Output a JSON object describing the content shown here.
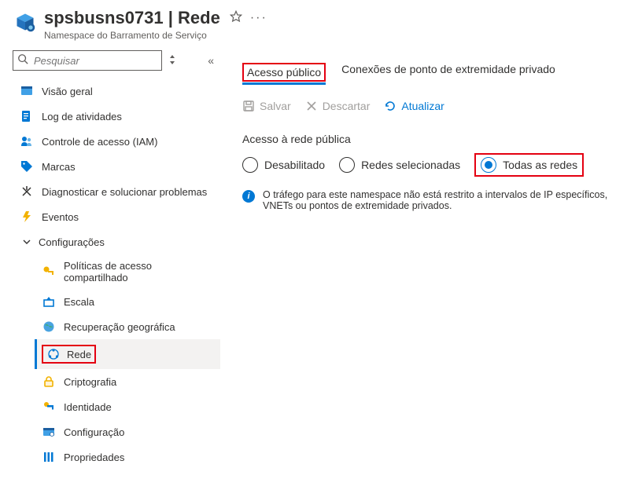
{
  "header": {
    "title": "spsbusns0731 | Rede",
    "subtitle": "Namespace do Barramento de Serviço"
  },
  "search": {
    "placeholder": "Pesquisar"
  },
  "sidebar": {
    "items": [
      {
        "label": "Visão geral"
      },
      {
        "label": "Log de atividades"
      },
      {
        "label": "Controle de acesso (IAM)"
      },
      {
        "label": "Marcas"
      },
      {
        "label": "Diagnosticar e solucionar problemas"
      },
      {
        "label": "Eventos"
      }
    ],
    "section": {
      "label": "Configurações"
    },
    "subitems": [
      {
        "label": "Políticas de acesso compartilhado"
      },
      {
        "label": "Escala"
      },
      {
        "label": "Recuperação geográfica"
      },
      {
        "label": "Rede"
      },
      {
        "label": "Criptografia"
      },
      {
        "label": "Identidade"
      },
      {
        "label": "Configuração"
      },
      {
        "label": "Propriedades"
      }
    ]
  },
  "tabs": {
    "public": "Acesso público",
    "private": "Conexões de ponto de extremidade privado"
  },
  "toolbar": {
    "save": "Salvar",
    "discard": "Descartar",
    "refresh": "Atualizar"
  },
  "access": {
    "label": "Acesso à rede pública",
    "options": {
      "disabled": "Desabilitado",
      "selected_networks": "Redes selecionadas",
      "all_networks": "Todas as redes"
    }
  },
  "info": {
    "text": "O tráfego para este namespace não está restrito a intervalos de IP específicos, VNETs ou pontos de extremidade privados."
  }
}
